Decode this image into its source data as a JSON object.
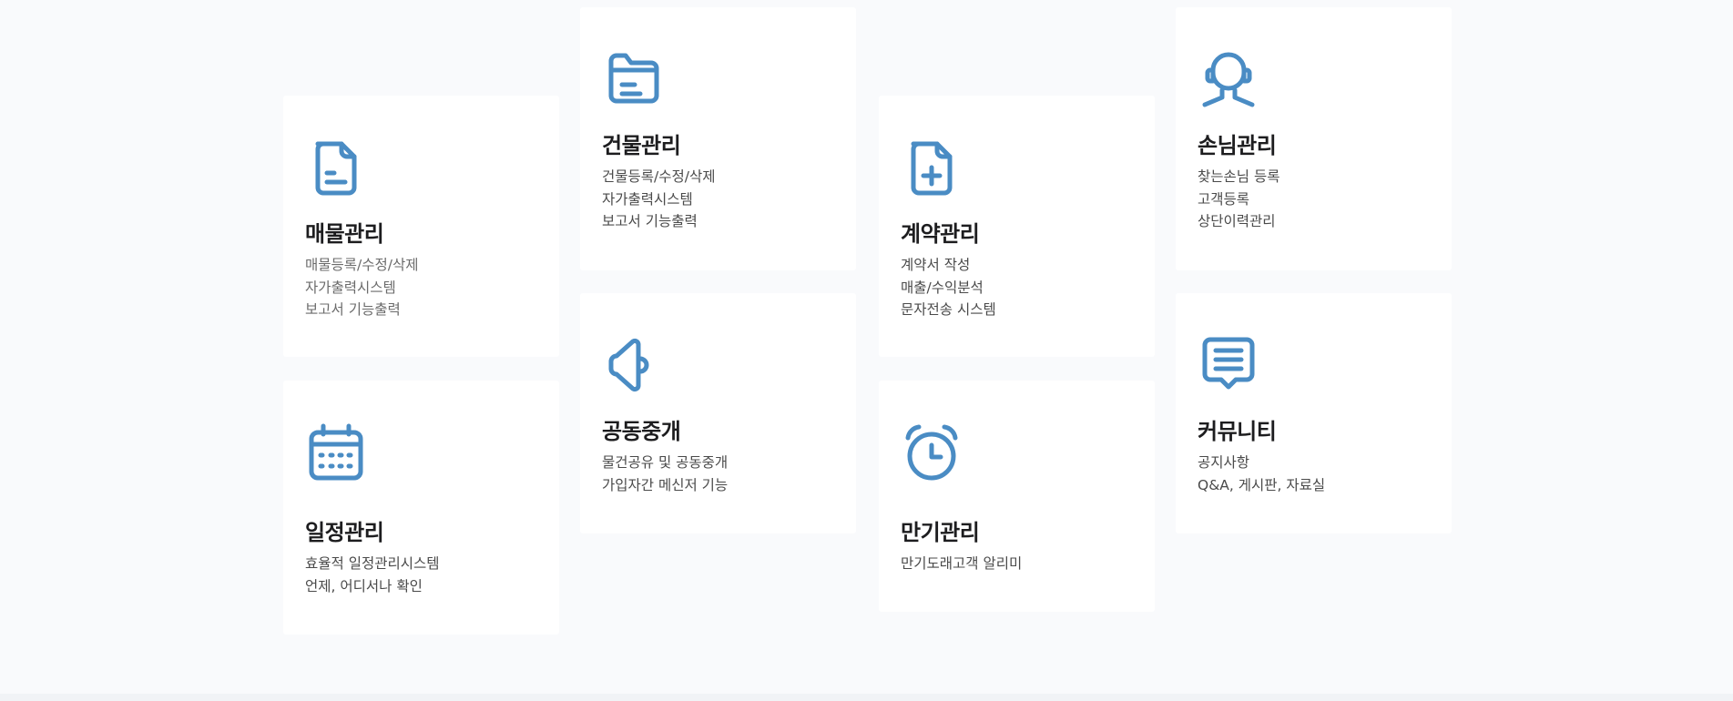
{
  "services": [
    {
      "id": "property",
      "icon": "document-icon",
      "title": "매물관리",
      "lines": [
        "매물등록/수정/삭제",
        "자가출력시스템",
        "보고서 기능출력"
      ]
    },
    {
      "id": "building",
      "icon": "folder-icon",
      "title": "건물관리",
      "lines": [
        "건물등록/수정/삭제",
        "자가출력시스템",
        "보고서 기능출력"
      ]
    },
    {
      "id": "contract",
      "icon": "document-plus-icon",
      "title": "계약관리",
      "lines": [
        "계약서 작성",
        "매출/수익분석",
        "문자전송 시스템"
      ]
    },
    {
      "id": "customer",
      "icon": "headset-user-icon",
      "title": "손님관리",
      "lines": [
        "찾는손님 등록",
        "고객등록",
        "상단이력관리"
      ]
    },
    {
      "id": "schedule",
      "icon": "calendar-icon",
      "title": "일정관리",
      "lines": [
        "효율적 일정관리시스템",
        "언제, 어디서나 확인"
      ]
    },
    {
      "id": "brokerage",
      "icon": "megaphone-icon",
      "title": "공동중개",
      "lines": [
        "물건공유 및 공동중개",
        "가입자간 메신저 기능"
      ]
    },
    {
      "id": "expiry",
      "icon": "alarm-clock-icon",
      "title": "만기관리",
      "lines": [
        "만기도래고객 알리미"
      ]
    },
    {
      "id": "community",
      "icon": "chat-bubble-icon",
      "title": "커뮤니티",
      "lines": [
        "공지사항",
        "Q&A, 게시판, 자료실"
      ]
    }
  ],
  "colors": {
    "icon": "#4a8cc4",
    "background": "#f9fafc",
    "card": "#ffffff",
    "title": "#1d1d1f"
  }
}
